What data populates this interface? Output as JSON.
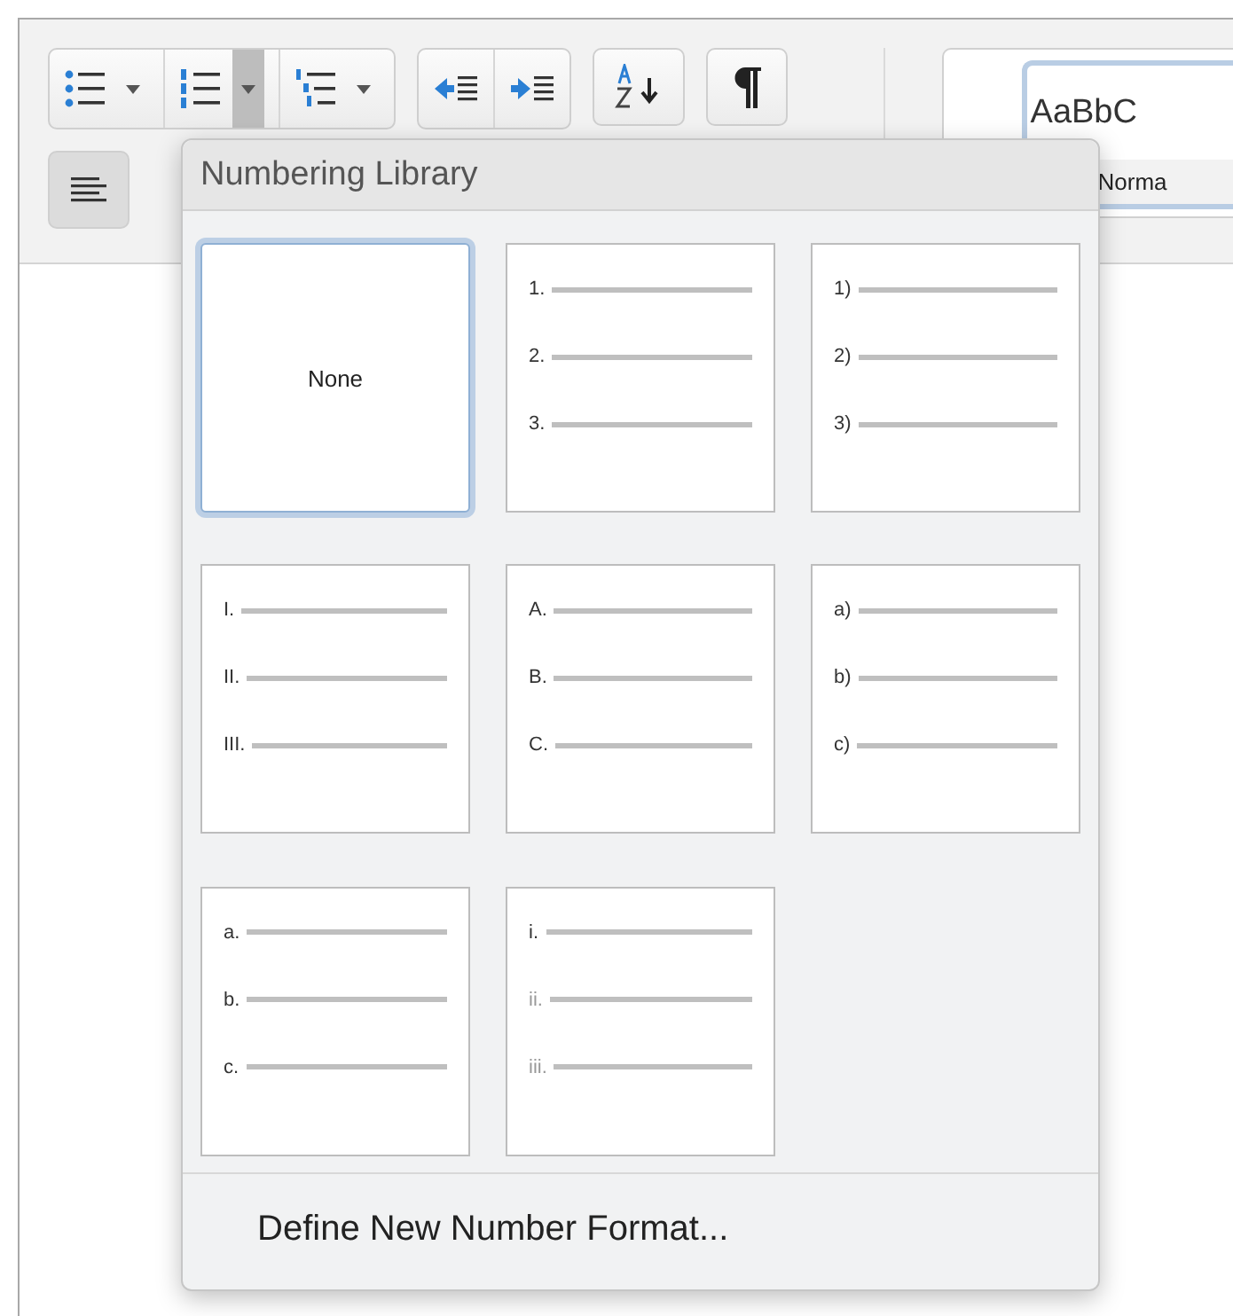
{
  "toolbar": {
    "list_buttons": [
      {
        "kind": "bullets",
        "selected": false
      },
      {
        "kind": "numbering",
        "selected": true
      },
      {
        "kind": "multilevel",
        "selected": false
      }
    ],
    "align_left": {
      "selected": true
    },
    "style_gallery": {
      "preview": "AaBbC",
      "name": "Norma",
      "selected": true
    }
  },
  "menu": {
    "title": "Numbering Library",
    "tiles": [
      {
        "kind": "none",
        "label": "None",
        "selected": true
      },
      {
        "kind": "list",
        "markers": [
          "1.",
          "2.",
          "3."
        ],
        "selected": false
      },
      {
        "kind": "list",
        "markers": [
          "1)",
          "2)",
          "3)"
        ],
        "selected": false
      },
      {
        "kind": "list",
        "markers": [
          "I.",
          "II.",
          "III."
        ],
        "selected": false
      },
      {
        "kind": "list",
        "markers": [
          "A.",
          "B.",
          "C."
        ],
        "selected": false
      },
      {
        "kind": "list",
        "markers": [
          "a)",
          "b)",
          "c)"
        ],
        "selected": false
      },
      {
        "kind": "list",
        "markers": [
          "a.",
          "b.",
          "c."
        ],
        "selected": false
      },
      {
        "kind": "list",
        "markers": [
          "i.",
          "ii.",
          "iii."
        ],
        "selected": false
      }
    ],
    "command": "Define New Number Format..."
  }
}
